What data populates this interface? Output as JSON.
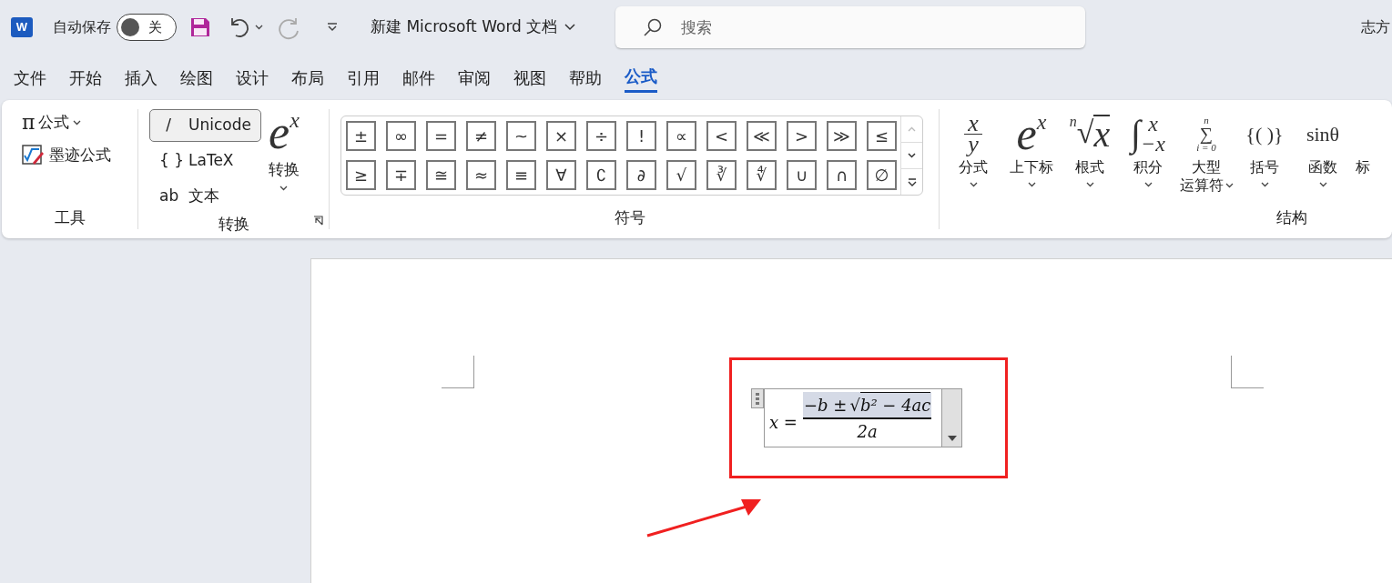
{
  "title_bar": {
    "app_logo_letter": "W",
    "autosave_label": "自动保存",
    "autosave_toggle": {
      "on": false,
      "label": "关"
    },
    "redo_disabled": true,
    "document_title": "新建 Microsoft Word 文档",
    "search": {
      "placeholder": "搜索"
    },
    "user_name": "志方"
  },
  "tabs": [
    {
      "label": "文件",
      "selected": false
    },
    {
      "label": "开始",
      "selected": false
    },
    {
      "label": "插入",
      "selected": false
    },
    {
      "label": "绘图",
      "selected": false
    },
    {
      "label": "设计",
      "selected": false
    },
    {
      "label": "布局",
      "selected": false
    },
    {
      "label": "引用",
      "selected": false
    },
    {
      "label": "邮件",
      "selected": false
    },
    {
      "label": "审阅",
      "selected": false
    },
    {
      "label": "视图",
      "selected": false
    },
    {
      "label": "帮助",
      "selected": false
    },
    {
      "label": "公式",
      "selected": true
    }
  ],
  "ribbon": {
    "tools": {
      "title": "工具",
      "equation": {
        "icon": "π",
        "label": "公式"
      },
      "ink_equation": "墨迹公式"
    },
    "convert": {
      "title": "转换",
      "formats": [
        {
          "icon": "/",
          "label": "Unicode",
          "selected": true
        },
        {
          "icon": "{ }",
          "label": "LaTeX",
          "selected": false
        },
        {
          "icon": "ab",
          "label": "文本",
          "selected": false
        }
      ],
      "convert_button": {
        "base": "e",
        "sup": "x",
        "label": "转换"
      }
    },
    "symbols": {
      "title": "符号",
      "items": [
        "±",
        "∞",
        "=",
        "≠",
        "~",
        "×",
        "÷",
        "!",
        "∝",
        "<",
        "≪",
        ">",
        "≫",
        "≤",
        "≥",
        "∓",
        "≅",
        "≈",
        "≡",
        "∀",
        "∁",
        "∂",
        "√",
        "∛",
        "∜",
        "∪",
        "∩",
        "∅"
      ]
    },
    "structures": {
      "title": "结构",
      "items": [
        {
          "kind": "fraction",
          "glyph": [
            "x",
            "y"
          ],
          "label": "分式"
        },
        {
          "kind": "script",
          "glyph": [
            "e",
            "x"
          ],
          "label": "上下标"
        },
        {
          "kind": "radical",
          "glyph": [
            "n",
            "√",
            "x"
          ],
          "label": "根式"
        },
        {
          "kind": "integral",
          "glyph": [
            "∫",
            "x",
            "−x"
          ],
          "label": "积分"
        },
        {
          "kind": "large_operator",
          "glyph": [
            "n",
            "∑",
            "i = 0"
          ],
          "label": "大型",
          "label_line2": "运算符"
        },
        {
          "kind": "bracket",
          "glyph": [
            "{( )}"
          ],
          "label": "括号"
        },
        {
          "kind": "function",
          "glyph": [
            "sinθ"
          ],
          "label": "函数"
        },
        {
          "kind": "plain",
          "label": "标"
        }
      ]
    }
  },
  "document": {
    "equation": {
      "lhs": "x =",
      "numerator_prefix": "−b ±",
      "radical_sign": "√",
      "radicand": "b² − 4ac",
      "denominator": "2a",
      "numerator_highlighted": true
    }
  }
}
